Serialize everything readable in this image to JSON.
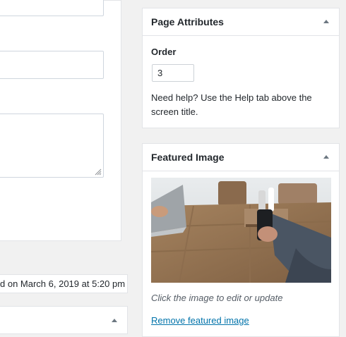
{
  "status_bar": {
    "text": "d on March 6, 2019 at 5:20 pm"
  },
  "page_attributes": {
    "title": "Page Attributes",
    "order_label": "Order",
    "order_value": "3",
    "help_text": "Need help? Use the Help tab above the screen title."
  },
  "featured_image": {
    "title": "Featured Image",
    "caption": "Click the image to edit or update",
    "remove_link": "Remove featured image"
  },
  "icons": {
    "toggle": "caret-up-icon",
    "resize": "resize-grip-icon"
  },
  "colors": {
    "link": "#0073aa",
    "border": "#e2e4e7",
    "background": "#f1f1f1"
  }
}
